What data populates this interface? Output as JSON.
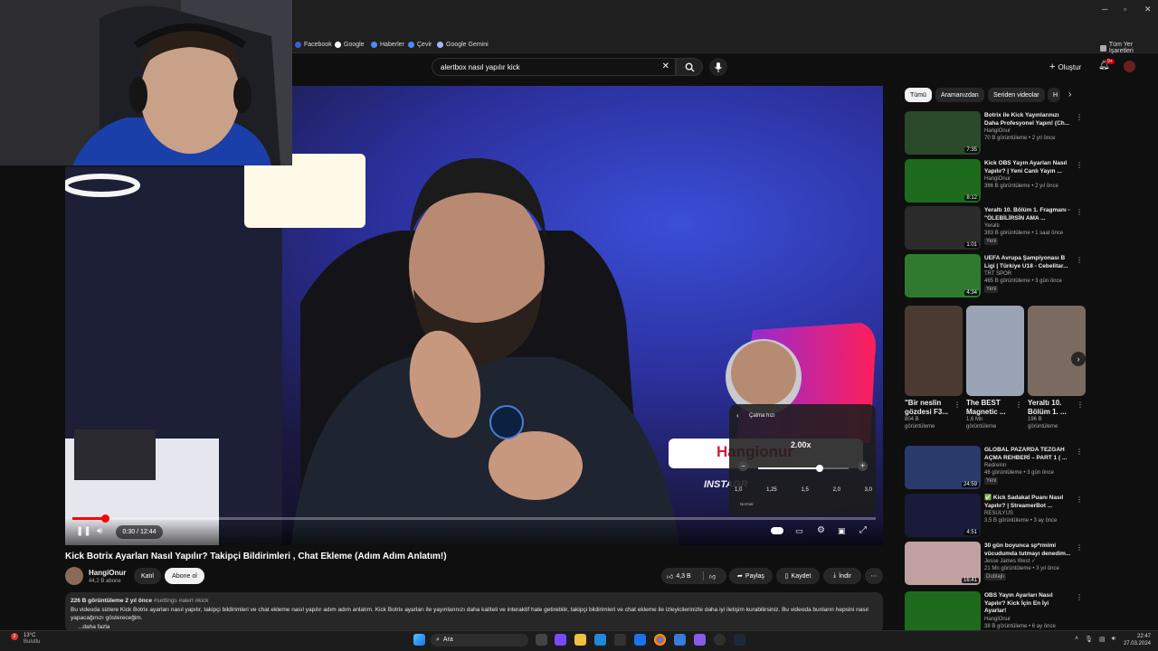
{
  "bookmarks": [
    "Facebook",
    "Google",
    "Haberler",
    "Çevir",
    "Google Gemini"
  ],
  "bookmarks_right": "Tüm Yer İşaretleri",
  "header": {
    "search_value": "alertbox nasıl yapılır kick",
    "create_label": "Oluştur",
    "notification_count": "9+"
  },
  "player": {
    "time": "0:30 / 12:44",
    "progress_fraction": 0.04,
    "overlay_brand": "Hangionur",
    "overlay_instagram": "INSTAGR",
    "speed_menu": {
      "title": "Çalma hızı",
      "value": "2.00x",
      "slider_fraction": 0.68,
      "minus": "−",
      "plus": "+",
      "presets": [
        "1,0",
        "1,25",
        "1,5",
        "2,0",
        "3,0"
      ],
      "normal_label": "Normal"
    }
  },
  "video": {
    "title": "Kick Botrix Ayarları Nasıl Yapılır? Takipçi Bildirimleri , Chat Ekleme (Adım Adım Anlatım!)",
    "channel": "HangiOnur",
    "subscribers": "44,2 B abone",
    "join_label": "Katıl",
    "subscribe_label": "Abone ol",
    "likes": "4,3 B",
    "share_label": "Paylaş",
    "save_label": "Kaydet",
    "download_label": "İndir"
  },
  "description": {
    "meta": "226 B görüntüleme  2 yıl önce",
    "tags": "#settings #alert #kick",
    "text": "Bu videoda sizlere Kick Botrix ayarları nasıl yapılır, takipçi bildirimleri ve chat ekleme nasıl yapılır adım adım anlatım. Kick Botrix ayarları ile yayınlarınızı daha kaliteli ve interaktif hale getirebilir, takipçi bildirimleri ve chat ekleme ile izleyicilerinizle daha iyi iletişim kurabilirsiniz. Bu videoda bunların hepsini nasıl yapacağınızı göstereceğim.",
    "more": "...daha fazla"
  },
  "sidebar": {
    "chips": [
      "Tümü",
      "Aramanızdan",
      "Seriden videolar",
      "H"
    ],
    "videos_top": [
      {
        "title": "Botrix ile Kick Yayınlarınızı Daha Profesyonel Yapın! (Ch...",
        "channel": "HangiOnur",
        "meta": "70 B görüntüleme • 2 yıl önce",
        "duration": "7:35",
        "badge": "",
        "thumb": "#2a4a2a"
      },
      {
        "title": "Kick OBS Yayın Ayarları Nasıl Yapılır? | Yeni Canlı Yayın ...",
        "channel": "HangiOnur",
        "meta": "366 B görüntüleme • 2 yıl önce",
        "duration": "8:12",
        "badge": "",
        "thumb": "#1e6b1e"
      },
      {
        "title": "Yeraltı 10. Bölüm 1. Fragmanı - \"ÖLEBİLİRSİN AMA ...",
        "channel": "Yeraltı",
        "meta": "383 B görüntüleme • 1 saat önce",
        "duration": "1:01",
        "badge": "Yeni",
        "thumb": "#2b2b2b"
      },
      {
        "title": "UEFA Avrupa Şampiyonası B Ligi | Türkiye U18 - Cebelitar...",
        "channel": "TRT SPOR",
        "meta": "465 B görüntüleme • 3 gün önce",
        "duration": "4:34",
        "badge": "Yeni",
        "thumb": "#2f7a2f"
      }
    ],
    "shorts": [
      {
        "title": "\"Bir neslin gözdesi F3...",
        "meta1": "804 B",
        "meta2": "görüntüleme",
        "bg": "#4a3a30"
      },
      {
        "title": "The BEST Magnetic ...",
        "meta1": "1,6 Mn",
        "meta2": "görüntüleme",
        "bg": "#9aa4b4"
      },
      {
        "title": "Yeraltı 10. Bölüm 1. ...",
        "meta1": "196 B",
        "meta2": "görüntüleme",
        "bg": "#7a6a60"
      }
    ],
    "videos_bottom": [
      {
        "title": "GLOBAL PAZARDA TEZGAH AÇMA REHBERİ – PART 1 ( ...",
        "channel": "Redreinn",
        "meta": "46 görüntüleme • 3 gün önce",
        "duration": "24:59",
        "badge": "Yeni",
        "thumb": "#2a3a6a"
      },
      {
        "title": "✅ Kick Sadakat Puanı Nasıl Yapılır? | StreamerBot ...",
        "channel": "RESULYUS",
        "meta": "3,5 B görüntüleme • 3 ay önce",
        "duration": "4:51",
        "badge": "",
        "thumb": "#1a1a3a"
      },
      {
        "title": "30 gün boyunca sp*rmimi vücudumda tutmayı denedim...",
        "channel": "Jesse James West ✓",
        "meta": "21 Mn görüntüleme • 3 yıl önce",
        "duration": "16:41",
        "badge": "Dublajlı",
        "thumb": "#c0a0a0"
      },
      {
        "title": "OBS Yayın Ayarları Nasıl Yapılır? Kick İçin En İyi Ayarlar!",
        "channel": "HangiOnur",
        "meta": "38 B görüntüleme • 6 ay önce",
        "duration": "",
        "badge": "",
        "thumb": "#1e6b1e"
      }
    ]
  },
  "taskbar": {
    "weather_temp": "13°C",
    "weather_desc": "Bulutlu",
    "weather_badge": "2",
    "search_label": "Ara",
    "time": "22:47",
    "date": "27.03.2024"
  },
  "colors": {
    "accent": "#ff0000",
    "background": "#0f0f0f",
    "chip_bg": "#272727"
  }
}
